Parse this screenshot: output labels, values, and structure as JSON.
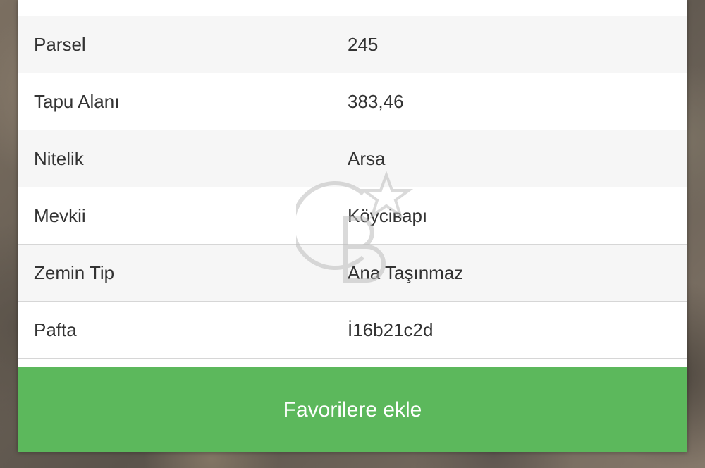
{
  "details": {
    "rows": [
      {
        "label": "",
        "value": ""
      },
      {
        "label": "Parsel",
        "value": "245"
      },
      {
        "label": "Tapu Alanı",
        "value": "383,46"
      },
      {
        "label": "Nitelik",
        "value": "Arsa"
      },
      {
        "label": "Mevkii",
        "value": "Köyciварı"
      },
      {
        "label": "Zemin Tip",
        "value": "Ana Taşınmaz"
      },
      {
        "label": "Pafta",
        "value": "İ16b21c2d"
      }
    ]
  },
  "actions": {
    "favorite_label": "Favorilere ekle",
    "favorite_color": "#5cb85c"
  },
  "watermark": {
    "icon": "cb-star-logo-icon"
  }
}
